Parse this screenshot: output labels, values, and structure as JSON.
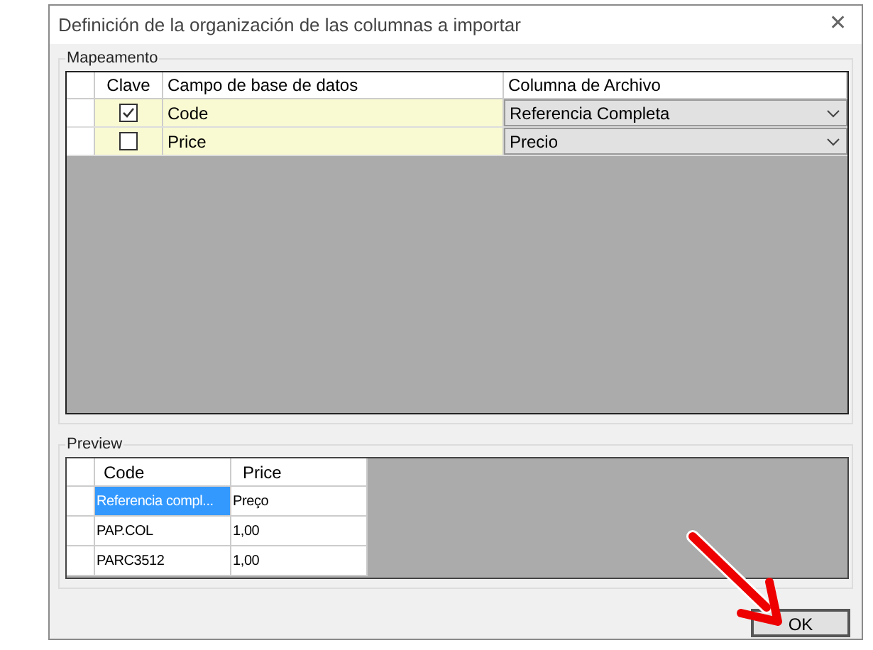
{
  "window": {
    "title": "Definición de la organización de las columnas a importar",
    "close": "✕"
  },
  "mapping": {
    "title": "Mapeamento",
    "columns": [
      "Clave",
      "Campo de base de datos",
      "Columna de Archivo"
    ],
    "rows": [
      {
        "checked": true,
        "field": "Code",
        "file_column": "Referencia Completa"
      },
      {
        "checked": false,
        "field": "Price",
        "file_column": "Precio"
      }
    ]
  },
  "preview": {
    "title": "Preview",
    "columns": [
      "Code",
      "Price"
    ],
    "rows": [
      {
        "selected": true,
        "cells": [
          "Referencia compl...",
          "Preço"
        ]
      },
      {
        "selected": false,
        "cells": [
          "PAP.COL",
          "1,00"
        ]
      },
      {
        "selected": false,
        "cells": [
          "PARC3512",
          "1,00"
        ]
      }
    ]
  },
  "ok_button": "OK"
}
